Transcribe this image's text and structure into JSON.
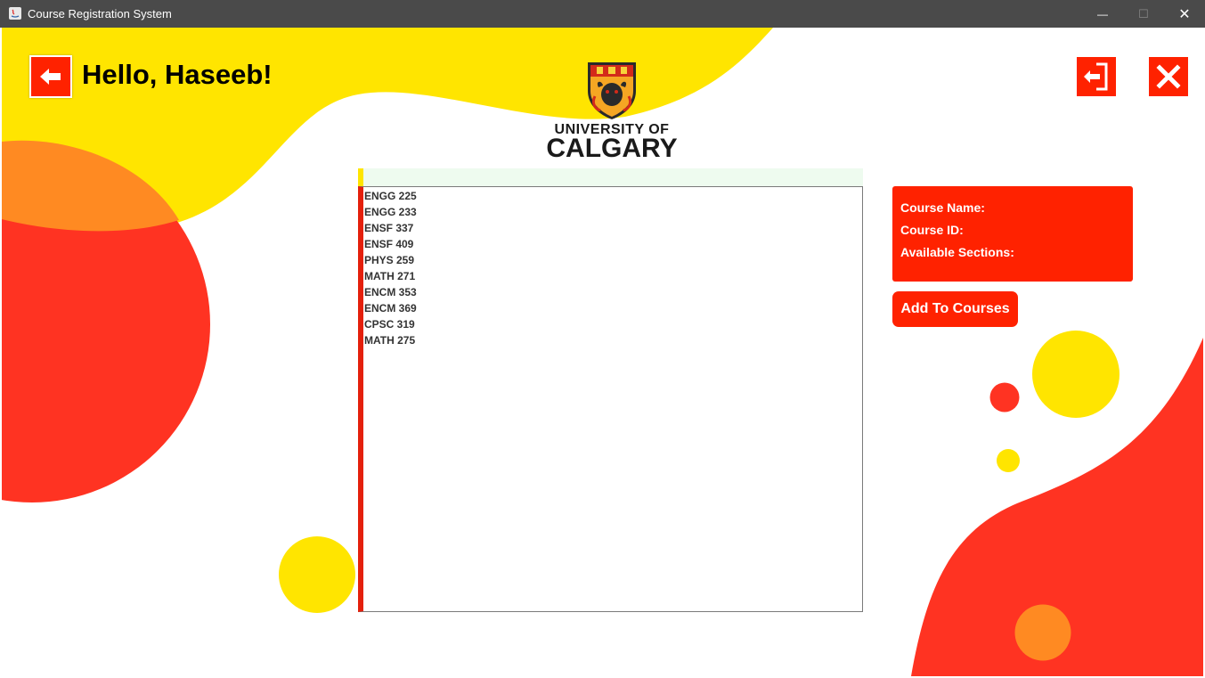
{
  "window": {
    "title": "Course Registration System",
    "minimize_glyph": "—",
    "maximize_glyph": "☐",
    "close_glyph": "✕"
  },
  "header": {
    "greeting": "Hello, Haseeb!",
    "logo_line1": "UNIVERSITY OF",
    "logo_line2": "CALGARY"
  },
  "icons": {
    "back": "arrow-left-icon",
    "logout": "logout-icon",
    "close": "close-icon"
  },
  "colors": {
    "yellow": "#ffe500",
    "red": "#ff3322",
    "orange": "#ff8a22",
    "button_red": "#ff2200",
    "search_bg": "#eefbef"
  },
  "courses": {
    "items": [
      "ENGG 225",
      "ENGG 233",
      "ENSF 337",
      "ENSF 409",
      "PHYS 259",
      "MATH 271",
      "ENCM 353",
      "ENCM 369",
      "CPSC 319",
      "MATH 275"
    ]
  },
  "details": {
    "course_name_label": "Course Name:",
    "course_id_label": "Course ID:",
    "sections_label": "Available Sections:"
  },
  "actions": {
    "add_label": "Add To Courses"
  }
}
